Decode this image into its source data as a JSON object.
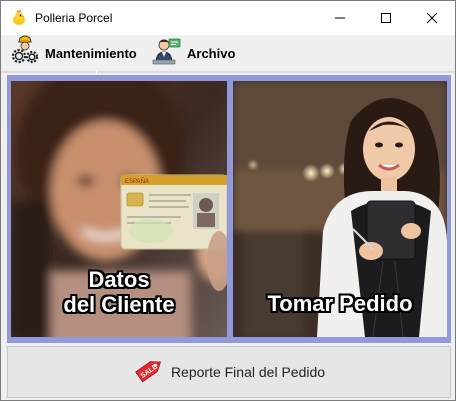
{
  "window": {
    "title": "Polleria Porcel",
    "icon": "chick-icon"
  },
  "menu": {
    "items": [
      {
        "label": "Mantenimiento",
        "icon": "gears-worker-icon"
      },
      {
        "label": "Archivo",
        "icon": "file-worker-icon"
      }
    ]
  },
  "cards": {
    "client": {
      "line1": "Datos",
      "line2": "del Cliente"
    },
    "order": {
      "label": "Tomar Pedido"
    }
  },
  "report": {
    "label": "Reporte Final del Pedido",
    "icon": "sale-tag-icon"
  },
  "colors": {
    "panel": "#9099d9",
    "accent_sale": "#e8282d"
  }
}
